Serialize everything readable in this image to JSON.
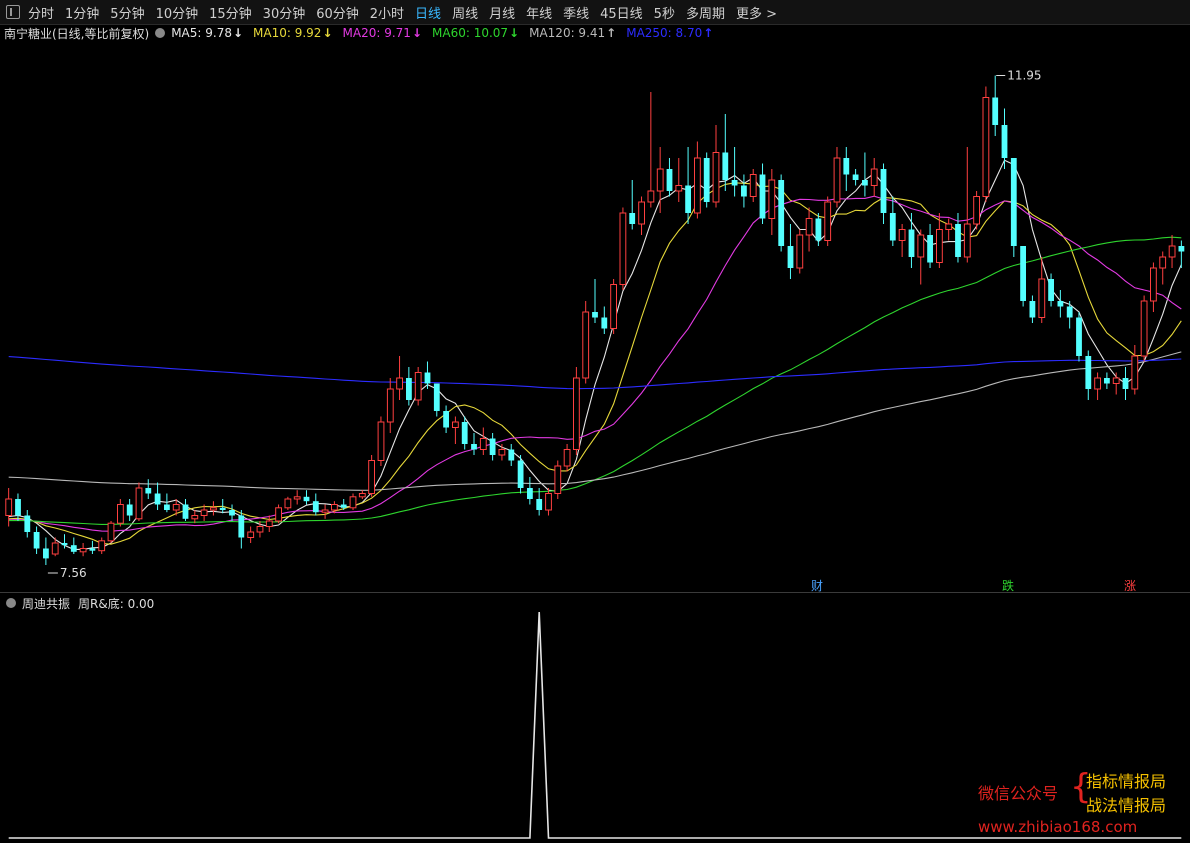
{
  "toolbar": {
    "periods": [
      "分时",
      "1分钟",
      "5分钟",
      "10分钟",
      "15分钟",
      "30分钟",
      "60分钟",
      "2小时",
      "日线",
      "周线",
      "月线",
      "年线",
      "季线",
      "45日线",
      "5秒",
      "多周期"
    ],
    "active_index": 8,
    "more_label": "更多"
  },
  "info": {
    "stock": "南宁糖业(日线,等比前复权)",
    "ma5": {
      "label": "MA5: 9.78",
      "arrow": "↓",
      "color": "#e6e6e6"
    },
    "ma10": {
      "label": "MA10: 9.92",
      "arrow": "↓",
      "color": "#e6d83a"
    },
    "ma20": {
      "label": "MA20: 9.71",
      "arrow": "↓",
      "color": "#e23ae2"
    },
    "ma60": {
      "label": "MA60: 10.07",
      "arrow": "↓",
      "color": "#2ed42e"
    },
    "ma120": {
      "label": "MA120: 9.41",
      "arrow": "↑",
      "color": "#b8b8b8"
    },
    "ma250": {
      "label": "MA250: 8.70",
      "arrow": "↑",
      "color": "#2c2cff"
    }
  },
  "price_labels": {
    "high": "11.95",
    "low": "7.56"
  },
  "events": {
    "cai": "财",
    "die": "跌",
    "zhang": "涨"
  },
  "subchart": {
    "name": "周迪共振",
    "value_label": "周R&底: 0.00"
  },
  "watermark": {
    "left": "微信公众号",
    "line1": "指标情报局",
    "line2": "战法情报局",
    "url": "www.zhibiao168.com"
  },
  "colors": {
    "up": "#ff4040",
    "down": "#54ffff",
    "active_tab": "#39b8ff"
  },
  "chart_data": {
    "type": "candlestick",
    "ohlc": [
      [
        7.95,
        8.2,
        7.85,
        8.1
      ],
      [
        8.1,
        8.15,
        7.9,
        7.95
      ],
      [
        7.95,
        8.0,
        7.75,
        7.8
      ],
      [
        7.8,
        7.85,
        7.6,
        7.65
      ],
      [
        7.65,
        7.75,
        7.5,
        7.56
      ],
      [
        7.6,
        7.75,
        7.58,
        7.7
      ],
      [
        7.7,
        7.78,
        7.65,
        7.68
      ],
      [
        7.68,
        7.75,
        7.6,
        7.62
      ],
      [
        7.62,
        7.7,
        7.58,
        7.65
      ],
      [
        7.65,
        7.72,
        7.6,
        7.63
      ],
      [
        7.63,
        7.75,
        7.6,
        7.72
      ],
      [
        7.72,
        7.9,
        7.7,
        7.88
      ],
      [
        7.88,
        8.1,
        7.85,
        8.05
      ],
      [
        8.05,
        8.1,
        7.9,
        7.95
      ],
      [
        7.92,
        8.25,
        7.9,
        8.2
      ],
      [
        8.2,
        8.28,
        8.1,
        8.15
      ],
      [
        8.15,
        8.25,
        8.0,
        8.05
      ],
      [
        8.05,
        8.15,
        7.98,
        8.0
      ],
      [
        8.0,
        8.1,
        7.95,
        8.05
      ],
      [
        8.05,
        8.1,
        7.9,
        7.92
      ],
      [
        7.92,
        8.0,
        7.88,
        7.95
      ],
      [
        7.95,
        8.05,
        7.9,
        8.0
      ],
      [
        8.0,
        8.08,
        7.95,
        8.02
      ],
      [
        8.02,
        8.1,
        7.97,
        8.0
      ],
      [
        8.0,
        8.05,
        7.9,
        7.95
      ],
      [
        7.95,
        8.0,
        7.65,
        7.75
      ],
      [
        7.75,
        7.85,
        7.7,
        7.8
      ],
      [
        7.8,
        7.9,
        7.75,
        7.85
      ],
      [
        7.85,
        7.95,
        7.8,
        7.9
      ],
      [
        7.9,
        8.05,
        7.88,
        8.02
      ],
      [
        8.02,
        8.12,
        8.0,
        8.1
      ],
      [
        8.1,
        8.18,
        8.05,
        8.12
      ],
      [
        8.12,
        8.18,
        8.05,
        8.08
      ],
      [
        8.08,
        8.15,
        7.95,
        7.98
      ],
      [
        7.98,
        8.05,
        7.92,
        8.0
      ],
      [
        8.0,
        8.08,
        7.97,
        8.05
      ],
      [
        8.05,
        8.1,
        8.0,
        8.02
      ],
      [
        8.02,
        8.15,
        8.0,
        8.12
      ],
      [
        8.12,
        8.18,
        8.1,
        8.15
      ],
      [
        8.15,
        8.5,
        8.12,
        8.45
      ],
      [
        8.45,
        8.85,
        8.4,
        8.8
      ],
      [
        8.8,
        9.2,
        8.7,
        9.1
      ],
      [
        9.1,
        9.4,
        9.0,
        9.2
      ],
      [
        9.2,
        9.3,
        8.95,
        9.0
      ],
      [
        9.0,
        9.3,
        8.95,
        9.25
      ],
      [
        9.25,
        9.35,
        9.1,
        9.15
      ],
      [
        9.15,
        9.15,
        8.85,
        8.9
      ],
      [
        8.9,
        8.95,
        8.7,
        8.75
      ],
      [
        8.75,
        8.85,
        8.6,
        8.8
      ],
      [
        8.8,
        8.85,
        8.55,
        8.6
      ],
      [
        8.6,
        8.7,
        8.5,
        8.55
      ],
      [
        8.55,
        8.75,
        8.5,
        8.65
      ],
      [
        8.65,
        8.7,
        8.45,
        8.5
      ],
      [
        8.5,
        8.6,
        8.45,
        8.55
      ],
      [
        8.55,
        8.6,
        8.4,
        8.45
      ],
      [
        8.45,
        8.5,
        8.15,
        8.2
      ],
      [
        8.2,
        8.3,
        8.05,
        8.1
      ],
      [
        8.1,
        8.2,
        7.95,
        8.0
      ],
      [
        8.0,
        8.2,
        7.95,
        8.15
      ],
      [
        8.15,
        8.45,
        8.1,
        8.4
      ],
      [
        8.4,
        8.6,
        8.35,
        8.55
      ],
      [
        8.55,
        9.3,
        8.5,
        9.2
      ],
      [
        9.2,
        9.9,
        9.15,
        9.8
      ],
      [
        9.8,
        10.1,
        9.7,
        9.75
      ],
      [
        9.75,
        9.85,
        9.6,
        9.65
      ],
      [
        9.65,
        10.1,
        9.6,
        10.05
      ],
      [
        10.05,
        10.75,
        10.0,
        10.7
      ],
      [
        10.7,
        11.0,
        10.55,
        10.6
      ],
      [
        10.6,
        10.85,
        10.5,
        10.8
      ],
      [
        10.8,
        11.8,
        10.75,
        10.9
      ],
      [
        10.9,
        11.3,
        10.7,
        11.1
      ],
      [
        11.1,
        11.2,
        10.85,
        10.9
      ],
      [
        10.9,
        11.2,
        10.8,
        10.95
      ],
      [
        10.95,
        11.3,
        10.6,
        10.7
      ],
      [
        10.7,
        11.35,
        10.65,
        11.2
      ],
      [
        11.2,
        11.25,
        10.75,
        10.8
      ],
      [
        10.8,
        11.5,
        10.75,
        11.25
      ],
      [
        11.25,
        11.6,
        10.9,
        11.0
      ],
      [
        11.0,
        11.3,
        10.85,
        10.95
      ],
      [
        10.95,
        11.05,
        10.75,
        10.85
      ],
      [
        10.85,
        11.1,
        10.8,
        11.05
      ],
      [
        11.05,
        11.15,
        10.6,
        10.65
      ],
      [
        10.65,
        11.1,
        10.5,
        11.0
      ],
      [
        11.0,
        11.05,
        10.35,
        10.4
      ],
      [
        10.4,
        10.6,
        10.1,
        10.2
      ],
      [
        10.2,
        10.55,
        10.15,
        10.5
      ],
      [
        10.5,
        10.75,
        10.35,
        10.65
      ],
      [
        10.65,
        10.7,
        10.4,
        10.45
      ],
      [
        10.45,
        10.85,
        10.4,
        10.8
      ],
      [
        10.8,
        11.3,
        10.75,
        11.2
      ],
      [
        11.2,
        11.3,
        10.9,
        11.05
      ],
      [
        11.05,
        11.1,
        10.95,
        11.0
      ],
      [
        11.0,
        11.25,
        10.85,
        10.95
      ],
      [
        10.95,
        11.2,
        10.85,
        11.1
      ],
      [
        11.1,
        11.15,
        10.6,
        10.7
      ],
      [
        10.7,
        10.85,
        10.4,
        10.45
      ],
      [
        10.45,
        10.6,
        10.3,
        10.55
      ],
      [
        10.55,
        10.7,
        10.2,
        10.3
      ],
      [
        10.3,
        10.55,
        10.05,
        10.5
      ],
      [
        10.5,
        10.6,
        10.2,
        10.25
      ],
      [
        10.25,
        10.7,
        10.2,
        10.55
      ],
      [
        10.55,
        10.65,
        10.45,
        10.6
      ],
      [
        10.6,
        10.7,
        10.25,
        10.3
      ],
      [
        10.3,
        11.3,
        10.25,
        10.6
      ],
      [
        10.6,
        10.9,
        10.55,
        10.85
      ],
      [
        10.85,
        11.85,
        10.8,
        11.75
      ],
      [
        11.75,
        11.95,
        11.4,
        11.5
      ],
      [
        11.5,
        11.65,
        11.1,
        11.2
      ],
      [
        11.2,
        11.2,
        10.3,
        10.4
      ],
      [
        10.4,
        10.35,
        9.85,
        9.9
      ],
      [
        9.9,
        9.95,
        9.7,
        9.75
      ],
      [
        9.75,
        10.3,
        9.7,
        10.1
      ],
      [
        10.1,
        10.15,
        9.85,
        9.9
      ],
      [
        9.9,
        10.0,
        9.75,
        9.85
      ],
      [
        9.85,
        9.9,
        9.65,
        9.75
      ],
      [
        9.75,
        9.8,
        9.35,
        9.4
      ],
      [
        9.4,
        9.45,
        9.0,
        9.1
      ],
      [
        9.1,
        9.25,
        9.0,
        9.2
      ],
      [
        9.2,
        9.25,
        9.1,
        9.15
      ],
      [
        9.15,
        9.25,
        9.05,
        9.2
      ],
      [
        9.2,
        9.3,
        9.0,
        9.1
      ],
      [
        9.1,
        9.5,
        9.05,
        9.4
      ],
      [
        9.4,
        9.95,
        9.35,
        9.9
      ],
      [
        9.9,
        10.25,
        9.8,
        10.2
      ],
      [
        10.2,
        10.35,
        10.05,
        10.3
      ],
      [
        10.3,
        10.5,
        10.2,
        10.4
      ],
      [
        10.4,
        10.45,
        10.2,
        10.35
      ]
    ],
    "ma_periods": [
      5,
      10,
      20,
      60,
      120,
      250
    ],
    "indicator": {
      "name": "周迪共振",
      "series": "周R&底",
      "spike_index": 57,
      "value": 0.0
    }
  }
}
